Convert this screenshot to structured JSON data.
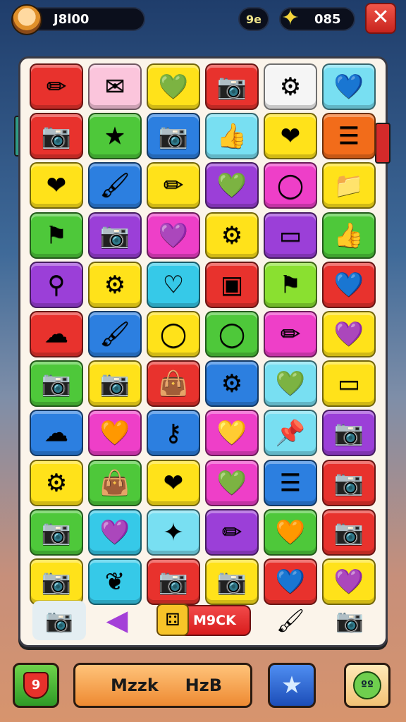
{
  "hud": {
    "score": "J8l00",
    "mid_value": "9e",
    "stars": "085",
    "close_symbol": "✕"
  },
  "colors": {
    "red": "#e8322d",
    "pink": "#fbc5dc",
    "yellow": "#ffe21a",
    "teal": "#36c9e8",
    "green": "#4ec83a",
    "blue": "#2c7fe0",
    "purple": "#9b3fd8",
    "magenta": "#ee3fc8",
    "orange": "#f26c1a",
    "white": "#f5f5f5",
    "lime": "#8ae030",
    "sky": "#78dff2"
  },
  "grid": [
    [
      {
        "c": "red",
        "i": "pencil-icon",
        "g": "✏"
      },
      {
        "c": "pink",
        "i": "envelope-icon",
        "g": "✉"
      },
      {
        "c": "yellow",
        "i": "heart-icon",
        "g": "💚"
      },
      {
        "c": "red",
        "i": "camera-icon",
        "g": "📷"
      },
      {
        "c": "white",
        "i": "gear-icon",
        "g": "⚙"
      },
      {
        "c": "sky",
        "i": "heart-icon",
        "g": "💙"
      }
    ],
    [
      {
        "c": "red",
        "i": "camera-icon",
        "g": "📷"
      },
      {
        "c": "green",
        "i": "star-icon",
        "g": "★"
      },
      {
        "c": "blue",
        "i": "camera-icon",
        "g": "📷"
      },
      {
        "c": "sky",
        "i": "thumb-icon",
        "g": "👍"
      },
      {
        "c": "yellow",
        "i": "heart-icon",
        "g": "❤"
      },
      {
        "c": "orange",
        "i": "list-icon",
        "g": "☰"
      }
    ],
    [
      {
        "c": "yellow",
        "i": "heart-icon",
        "g": "❤"
      },
      {
        "c": "blue",
        "i": "brush-icon",
        "g": "🖌"
      },
      {
        "c": "yellow",
        "i": "pencil-icon",
        "g": "✏"
      },
      {
        "c": "purple",
        "i": "heart-icon",
        "g": "💚"
      },
      {
        "c": "magenta",
        "i": "ring-icon",
        "g": "◯"
      },
      {
        "c": "yellow",
        "i": "folder-icon",
        "g": "📁"
      }
    ],
    [
      {
        "c": "green",
        "i": "flag-icon",
        "g": "⚑"
      },
      {
        "c": "purple",
        "i": "camera-icon",
        "g": "📷"
      },
      {
        "c": "magenta",
        "i": "heart-icon",
        "g": "💜"
      },
      {
        "c": "yellow",
        "i": "gear-icon",
        "g": "⚙"
      },
      {
        "c": "purple",
        "i": "card-icon",
        "g": "▭"
      },
      {
        "c": "green",
        "i": "thumb-icon",
        "g": "👍"
      }
    ],
    [
      {
        "c": "purple",
        "i": "wand-icon",
        "g": "⚲"
      },
      {
        "c": "yellow",
        "i": "gear-icon",
        "g": "⚙"
      },
      {
        "c": "teal",
        "i": "heart-icon",
        "g": "♡"
      },
      {
        "c": "red",
        "i": "monitor-icon",
        "g": "▣"
      },
      {
        "c": "lime",
        "i": "flag-icon",
        "g": "⚑"
      },
      {
        "c": "red",
        "i": "heart-icon",
        "g": "💙"
      }
    ],
    [
      {
        "c": "red",
        "i": "cloud-icon",
        "g": "☁"
      },
      {
        "c": "blue",
        "i": "brush-icon",
        "g": "🖌"
      },
      {
        "c": "yellow",
        "i": "ring-icon",
        "g": "◯"
      },
      {
        "c": "green",
        "i": "ring-icon",
        "g": "◯"
      },
      {
        "c": "magenta",
        "i": "pencil-icon",
        "g": "✏"
      },
      {
        "c": "yellow",
        "i": "heart-icon",
        "g": "💜"
      }
    ],
    [
      {
        "c": "green",
        "i": "camera-icon",
        "g": "📷"
      },
      {
        "c": "yellow",
        "i": "camera-icon",
        "g": "📷"
      },
      {
        "c": "red",
        "i": "bag-icon",
        "g": "👜"
      },
      {
        "c": "blue",
        "i": "gear-icon",
        "g": "⚙"
      },
      {
        "c": "sky",
        "i": "heart-icon",
        "g": "💚"
      },
      {
        "c": "yellow",
        "i": "card-icon",
        "g": "▭"
      }
    ],
    [
      {
        "c": "blue",
        "i": "cloud-icon",
        "g": "☁"
      },
      {
        "c": "magenta",
        "i": "heart-icon",
        "g": "🧡"
      },
      {
        "c": "blue",
        "i": "key-icon",
        "g": "⚷"
      },
      {
        "c": "magenta",
        "i": "heart-icon",
        "g": "💛"
      },
      {
        "c": "sky",
        "i": "pin-icon",
        "g": "📌"
      },
      {
        "c": "purple",
        "i": "camera-icon",
        "g": "📷"
      }
    ],
    [
      {
        "c": "yellow",
        "i": "gear-icon",
        "g": "⚙"
      },
      {
        "c": "green",
        "i": "bag-icon",
        "g": "👜"
      },
      {
        "c": "yellow",
        "i": "heart-icon",
        "g": "❤"
      },
      {
        "c": "magenta",
        "i": "heart-icon",
        "g": "💚"
      },
      {
        "c": "blue",
        "i": "list-icon",
        "g": "☰"
      },
      {
        "c": "red",
        "i": "camera-icon",
        "g": "📷"
      }
    ],
    [
      {
        "c": "green",
        "i": "camera-icon",
        "g": "📷"
      },
      {
        "c": "teal",
        "i": "heart-icon",
        "g": "💜"
      },
      {
        "c": "sky",
        "i": "star-icon",
        "g": "✦"
      },
      {
        "c": "purple",
        "i": "pencil-icon",
        "g": "✏"
      },
      {
        "c": "green",
        "i": "heart-icon",
        "g": "🧡"
      },
      {
        "c": "red",
        "i": "camera-icon",
        "g": "📷"
      }
    ],
    [
      {
        "c": "yellow",
        "i": "camera-icon",
        "g": "📷"
      },
      {
        "c": "teal",
        "i": "leaf-icon",
        "g": "❦"
      },
      {
        "c": "red",
        "i": "camera-icon",
        "g": "📷"
      },
      {
        "c": "yellow",
        "i": "camera-icon",
        "g": "📷"
      },
      {
        "c": "red",
        "i": "heart-icon",
        "g": "💙"
      },
      {
        "c": "yellow",
        "i": "heart-icon",
        "g": "💜"
      }
    ]
  ],
  "tools": {
    "mock_label": "M9CK",
    "mock_badge": "⚃"
  },
  "bottom": {
    "level": "9",
    "left_label": "Mzzk",
    "right_label": "HzB",
    "emote": "ºº"
  }
}
